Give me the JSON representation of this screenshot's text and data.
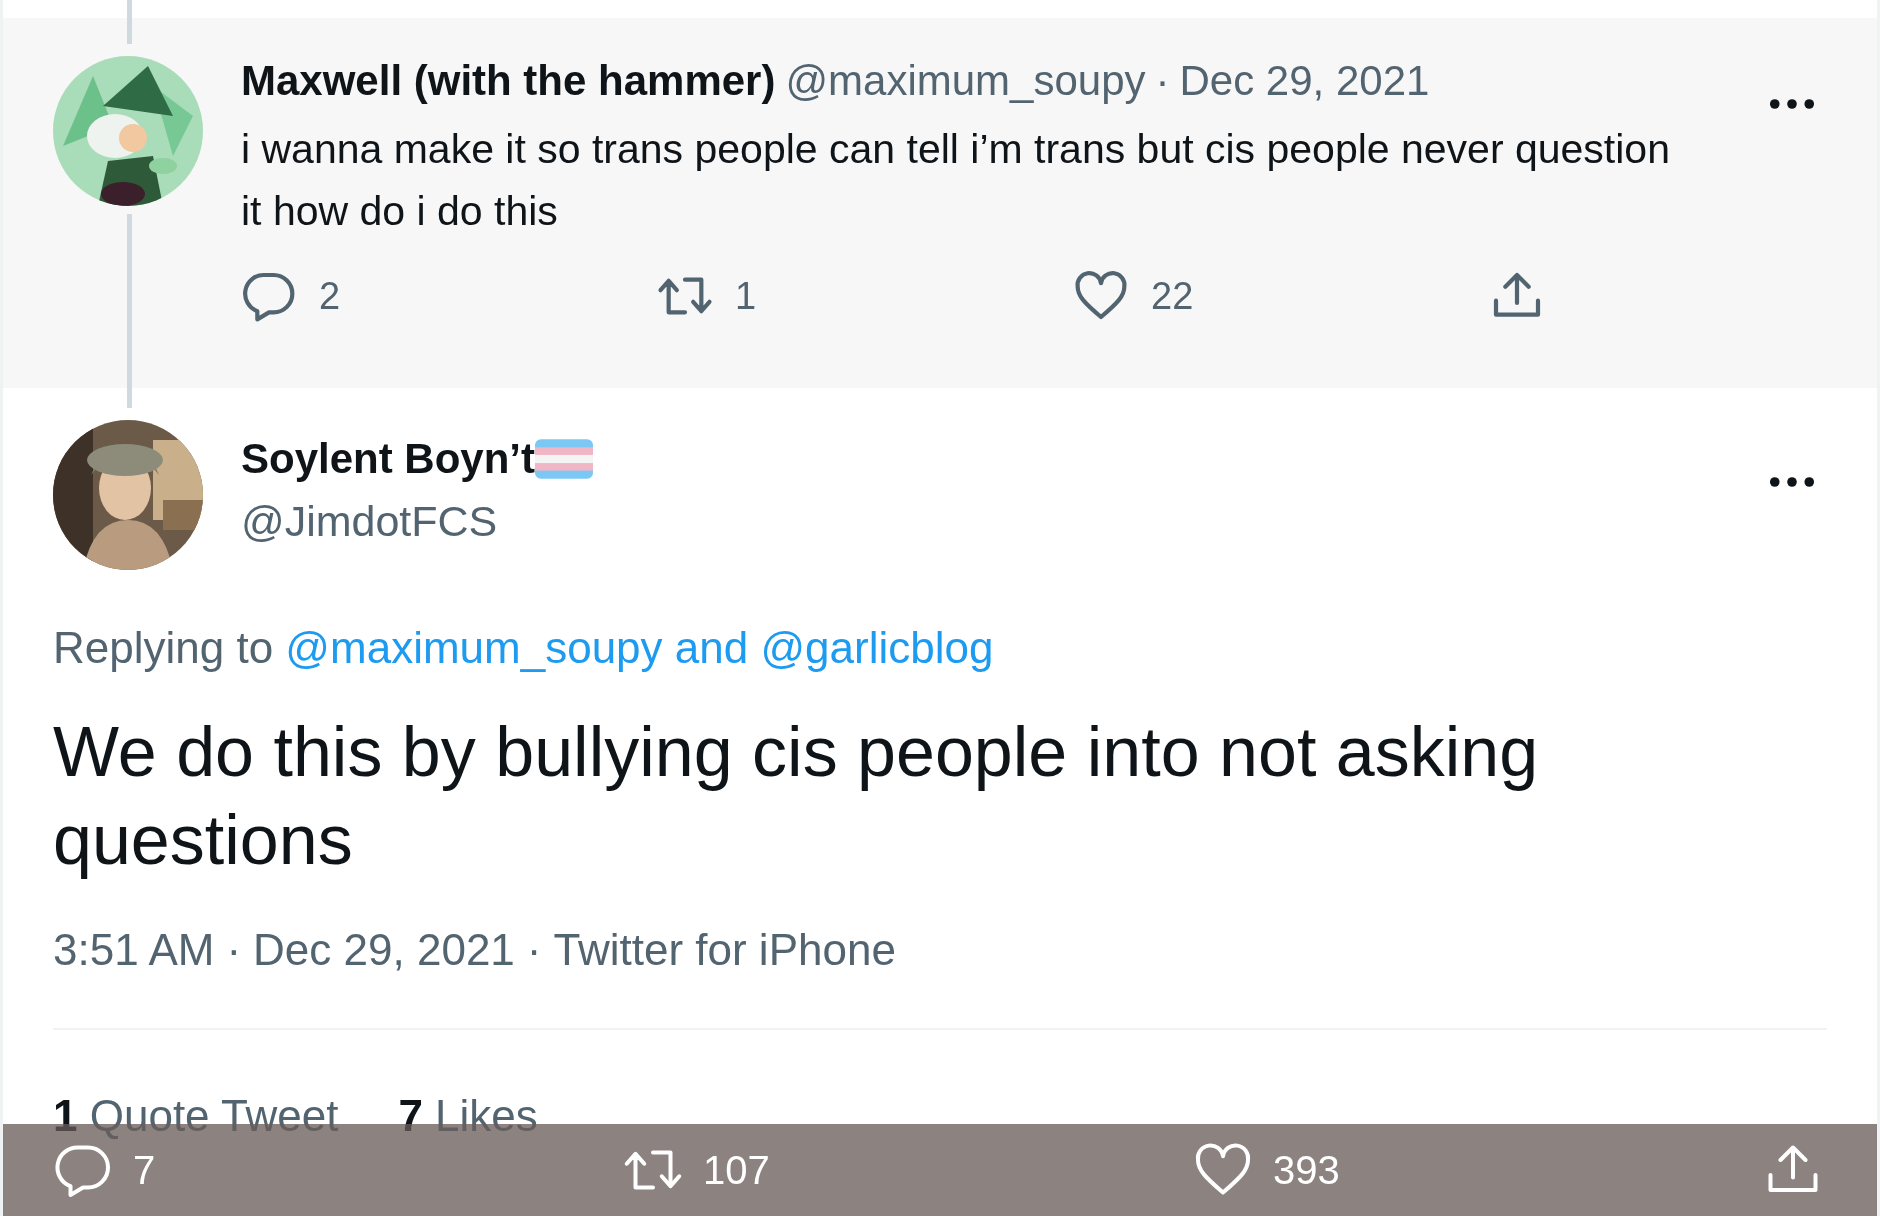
{
  "parent_tweet": {
    "name": "Maxwell (with the hammer)",
    "handle": "@maximum_soupy",
    "separator": "·",
    "date": "Dec 29, 2021",
    "text": "i wanna make it so trans people can tell i’m trans but cis people never question it how do i do this",
    "actions": [
      {
        "kind": "reply",
        "count": "2"
      },
      {
        "kind": "retweet",
        "count": "1"
      },
      {
        "kind": "like",
        "count": "22"
      },
      {
        "kind": "share"
      }
    ]
  },
  "tweet": {
    "name": "Soylent Boyn’t",
    "handle": "@JimdotFCS",
    "replying_label": "Replying to",
    "replying_to": "@maximum_soupy and @garlicblog",
    "text": "We do this by bullying cis people into not asking questions",
    "time": "3:51 AM",
    "date": "Dec 29, 2021",
    "source": "Twitter for iPhone",
    "separator": "·",
    "stats": [
      {
        "count": "1",
        "label": "Quote Tweet"
      },
      {
        "count": "7",
        "label": "Likes"
      }
    ]
  },
  "overlay_bar": {
    "actions": [
      {
        "kind": "reply",
        "count": "7"
      },
      {
        "kind": "retweet",
        "count": "107"
      },
      {
        "kind": "like",
        "count": "393"
      },
      {
        "kind": "share"
      }
    ]
  }
}
